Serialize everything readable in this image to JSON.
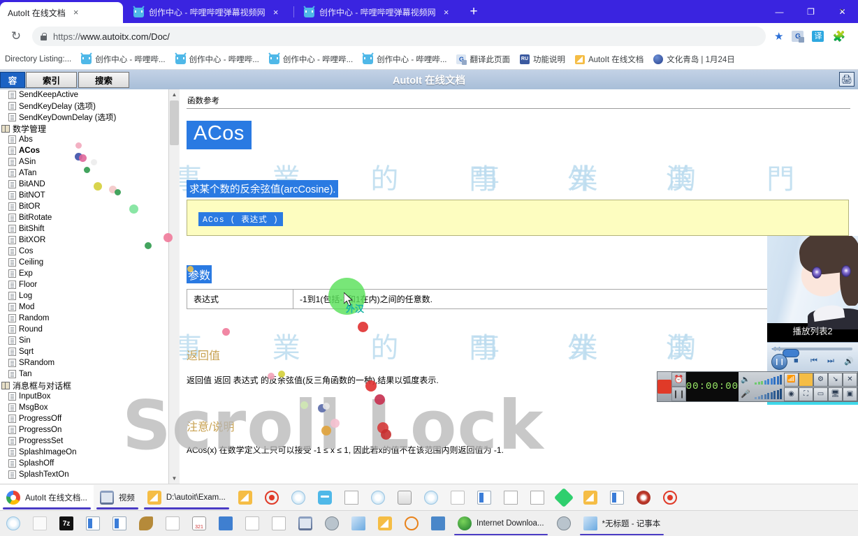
{
  "browser": {
    "tabs": [
      {
        "title": "AutoIt 在线文档",
        "active": true,
        "icon": "autoit-icon",
        "close": "×"
      },
      {
        "title": "创作中心 - 哔哩哔哩弹幕视频网",
        "active": false,
        "icon": "bilibili-icon",
        "close": "×"
      },
      {
        "title": "创作中心 - 哔哩哔哩弹幕视频网",
        "active": false,
        "icon": "bilibili-icon",
        "close": "×"
      }
    ],
    "new_tab_label": "+",
    "window_controls": {
      "minimize": "—",
      "maximize": "❐",
      "close": "✕"
    },
    "reload_label": "↻",
    "url_scheme": "https://",
    "url_rest": "www.autoitx.com/Doc/",
    "toolbar_icons": [
      "bookmark-star-icon",
      "google-translate-icon",
      "translate-icon",
      "extensions-puzzle-icon"
    ]
  },
  "bookmarks": [
    {
      "label": "Directory Listing:...",
      "icon": "none"
    },
    {
      "label": "创作中心 - 哔哩哔...",
      "icon": "bilibili-icon"
    },
    {
      "label": "创作中心 - 哔哩哔...",
      "icon": "bilibili-icon"
    },
    {
      "label": "创作中心 - 哔哩哔...",
      "icon": "bilibili-icon"
    },
    {
      "label": "创作中心 - 哔哩哔...",
      "icon": "bilibili-icon"
    },
    {
      "label": "翻译此页面",
      "icon": "google-translate-icon"
    },
    {
      "label": "功能说明",
      "icon": "ru-icon"
    },
    {
      "label": "AutoIt 在线文档",
      "icon": "folder-icon"
    },
    {
      "label": "文化青岛 | 1月24日",
      "icon": "globe-icon"
    }
  ],
  "help_app": {
    "title": "AutoIt 在线文档",
    "tabs": [
      {
        "label": "容",
        "selected": true
      },
      {
        "label": "索引",
        "selected": false
      },
      {
        "label": "搜索",
        "selected": false
      }
    ],
    "print_icon": "printer-icon",
    "tree": [
      {
        "label": "SendKeepActive",
        "type": "leaf",
        "bold": false
      },
      {
        "label": "SendKeyDelay (选项)",
        "type": "leaf",
        "bold": false
      },
      {
        "label": "SendKeyDownDelay (选项)",
        "type": "leaf",
        "bold": false
      },
      {
        "label": "数学管理",
        "type": "group",
        "bold": false
      },
      {
        "label": "Abs",
        "type": "leaf",
        "bold": false
      },
      {
        "label": "ACos",
        "type": "leaf",
        "bold": true
      },
      {
        "label": "ASin",
        "type": "leaf",
        "bold": false
      },
      {
        "label": "ATan",
        "type": "leaf",
        "bold": false
      },
      {
        "label": "BitAND",
        "type": "leaf",
        "bold": false
      },
      {
        "label": "BitNOT",
        "type": "leaf",
        "bold": false
      },
      {
        "label": "BitOR",
        "type": "leaf",
        "bold": false
      },
      {
        "label": "BitRotate",
        "type": "leaf",
        "bold": false
      },
      {
        "label": "BitShift",
        "type": "leaf",
        "bold": false
      },
      {
        "label": "BitXOR",
        "type": "leaf",
        "bold": false
      },
      {
        "label": "Cos",
        "type": "leaf",
        "bold": false
      },
      {
        "label": "Ceiling",
        "type": "leaf",
        "bold": false
      },
      {
        "label": "Exp",
        "type": "leaf",
        "bold": false
      },
      {
        "label": "Floor",
        "type": "leaf",
        "bold": false
      },
      {
        "label": "Log",
        "type": "leaf",
        "bold": false
      },
      {
        "label": "Mod",
        "type": "leaf",
        "bold": false
      },
      {
        "label": "Random",
        "type": "leaf",
        "bold": false
      },
      {
        "label": "Round",
        "type": "leaf",
        "bold": false
      },
      {
        "label": "Sin",
        "type": "leaf",
        "bold": false
      },
      {
        "label": "Sqrt",
        "type": "leaf",
        "bold": false
      },
      {
        "label": "SRandom",
        "type": "leaf",
        "bold": false
      },
      {
        "label": "Tan",
        "type": "leaf",
        "bold": false
      },
      {
        "label": "消息框与对话框",
        "type": "group",
        "bold": false
      },
      {
        "label": "InputBox",
        "type": "leaf",
        "bold": false
      },
      {
        "label": "MsgBox",
        "type": "leaf",
        "bold": false
      },
      {
        "label": "ProgressOff",
        "type": "leaf",
        "bold": false
      },
      {
        "label": "ProgressOn",
        "type": "leaf",
        "bold": false
      },
      {
        "label": "ProgressSet",
        "type": "leaf",
        "bold": false
      },
      {
        "label": "SplashImageOn",
        "type": "leaf",
        "bold": false
      },
      {
        "label": "SplashOff",
        "type": "leaf",
        "bold": false
      },
      {
        "label": "SplashTextOn",
        "type": "leaf",
        "bold": false
      }
    ],
    "content": {
      "breadcrumb": "函数参考",
      "title": "ACos",
      "description": "求某个数的反余弦值(arcCosine).",
      "code": "ACos ( 表达式 )",
      "params_heading": "参数",
      "params_table": [
        {
          "name": "表达式",
          "desc": "-1到1(包括-1和1在内)之间的任意数."
        }
      ],
      "return_heading": "返回值",
      "return_text": "返回值 返回 表达式 的反余弦值(反三角函数的一种),结果以弧度表示.",
      "notes_heading": "注意/说明",
      "notes_text": "ACos(x) 在数学定义上只可以接受 -1 ≤ x ≤ 1, 因此若x的值不在该范围内则返回值为 -1."
    }
  },
  "overlays": {
    "watermark_text": "Scroll Lock",
    "seal_chars": "事 業 的 門 外 漢",
    "ime_hint": "外汉",
    "cursor": "pointer-arrow"
  },
  "video_player": {
    "caption": "播放列表2",
    "buttons": [
      "pause-button",
      "stop-button",
      "previous-button",
      "next-button",
      "volume-button"
    ]
  },
  "media_bar": {
    "time_display": "00:00:00",
    "stop_icon": "stop-icon",
    "alarm_icon": "alarm-clock-icon",
    "pause_icon": "pause-icon",
    "volume_icon": "speaker-icon",
    "mic_icon": "microphone-icon",
    "buttons": [
      "wifi-icon",
      "folder-icon",
      "gear-icon",
      "minimize-icon",
      "close-icon",
      "webcam-icon",
      "fullscreen-icon",
      "window-icon",
      "monitor-icon",
      "region-icon"
    ]
  },
  "taskbar_row1": [
    {
      "label": "AutoIt 在线文档...",
      "icon": "chrome-icon",
      "active": true,
      "running": true
    },
    {
      "label": "视频",
      "icon": "film-icon",
      "active": false,
      "running": true
    },
    {
      "label": "D:\\autoit\\Exam...",
      "icon": "folder-icon",
      "active": false,
      "running": true
    },
    {
      "label": "",
      "icon": "folder-icon",
      "active": false,
      "running": false
    },
    {
      "label": "",
      "icon": "record-icon",
      "active": false,
      "running": false
    },
    {
      "label": "",
      "icon": "atom-icon",
      "active": false,
      "running": false
    },
    {
      "label": "",
      "icon": "bilibili-icon",
      "active": false,
      "running": false
    },
    {
      "label": "",
      "icon": "blueprint-icon",
      "active": false,
      "running": false
    },
    {
      "label": "",
      "icon": "swirl-icon",
      "active": false,
      "running": false
    },
    {
      "label": "",
      "icon": "stack-icon",
      "active": false,
      "running": false
    },
    {
      "label": "",
      "icon": "atom2-icon",
      "active": false,
      "running": false
    },
    {
      "label": "",
      "icon": "document-icon",
      "active": false,
      "running": false
    },
    {
      "label": "",
      "icon": "window-icon",
      "active": false,
      "running": false
    },
    {
      "label": "",
      "icon": "music-icon",
      "active": false,
      "running": false
    },
    {
      "label": "",
      "icon": "r-icon",
      "active": false,
      "running": false
    },
    {
      "label": "",
      "icon": "green-diamond-icon",
      "active": false,
      "running": false
    },
    {
      "label": "",
      "icon": "files-icon",
      "active": false,
      "running": false
    },
    {
      "label": "",
      "icon": "window2-icon",
      "active": false,
      "running": false
    },
    {
      "label": "",
      "icon": "target-icon",
      "active": false,
      "running": false
    },
    {
      "label": "",
      "icon": "record2-icon",
      "active": false,
      "running": false
    }
  ],
  "taskbar_row2": [
    {
      "label": "",
      "icon": "balloon-icon",
      "active": false,
      "running": false
    },
    {
      "label": "",
      "icon": "stamp-icon",
      "active": false,
      "running": false
    },
    {
      "label": "",
      "icon": "7zip-icon",
      "active": false,
      "running": false
    },
    {
      "label": "",
      "icon": "window-icon",
      "active": false,
      "running": false
    },
    {
      "label": "",
      "icon": "window-icon",
      "active": false,
      "running": false
    },
    {
      "label": "",
      "icon": "worm-icon",
      "active": false,
      "running": false
    },
    {
      "label": "",
      "icon": "document-icon",
      "active": false,
      "running": false
    },
    {
      "label": "",
      "icon": "calendar-icon",
      "active": false,
      "running": false
    },
    {
      "label": "",
      "icon": "blue-book-icon",
      "active": false,
      "running": false
    },
    {
      "label": "",
      "icon": "document-icon",
      "active": false,
      "running": false
    },
    {
      "label": "",
      "icon": "click-icon",
      "active": false,
      "running": false
    },
    {
      "label": "",
      "icon": "filmstrip-icon",
      "active": false,
      "running": false
    },
    {
      "label": "",
      "icon": "updater-icon",
      "active": false,
      "running": false
    },
    {
      "label": "",
      "icon": "notebook-icon",
      "active": false,
      "running": false
    },
    {
      "label": "",
      "icon": "magnifier-doc-icon",
      "active": false,
      "running": false
    },
    {
      "label": "",
      "icon": "magnifier-icon",
      "active": false,
      "running": false
    },
    {
      "label": "",
      "icon": "person-icon",
      "active": false,
      "running": false
    },
    {
      "label": "Internet Downloa...",
      "icon": "idm-icon",
      "active": false,
      "running": true
    },
    {
      "label": "",
      "icon": "updater-icon",
      "active": false,
      "running": false
    },
    {
      "label": "*无标题 - 记事本",
      "icon": "notepad-icon",
      "active": false,
      "running": true
    }
  ],
  "tray": {
    "chevron": "⌃"
  },
  "colors": {
    "chrome_blue": "#3a24e0",
    "help_accent": "#2a7ae2",
    "code_bg": "#fdfdc0",
    "section_heading": "#c8a252",
    "highlight_green": "#5ae05a",
    "cyan_strip": "#3fd8ea"
  }
}
